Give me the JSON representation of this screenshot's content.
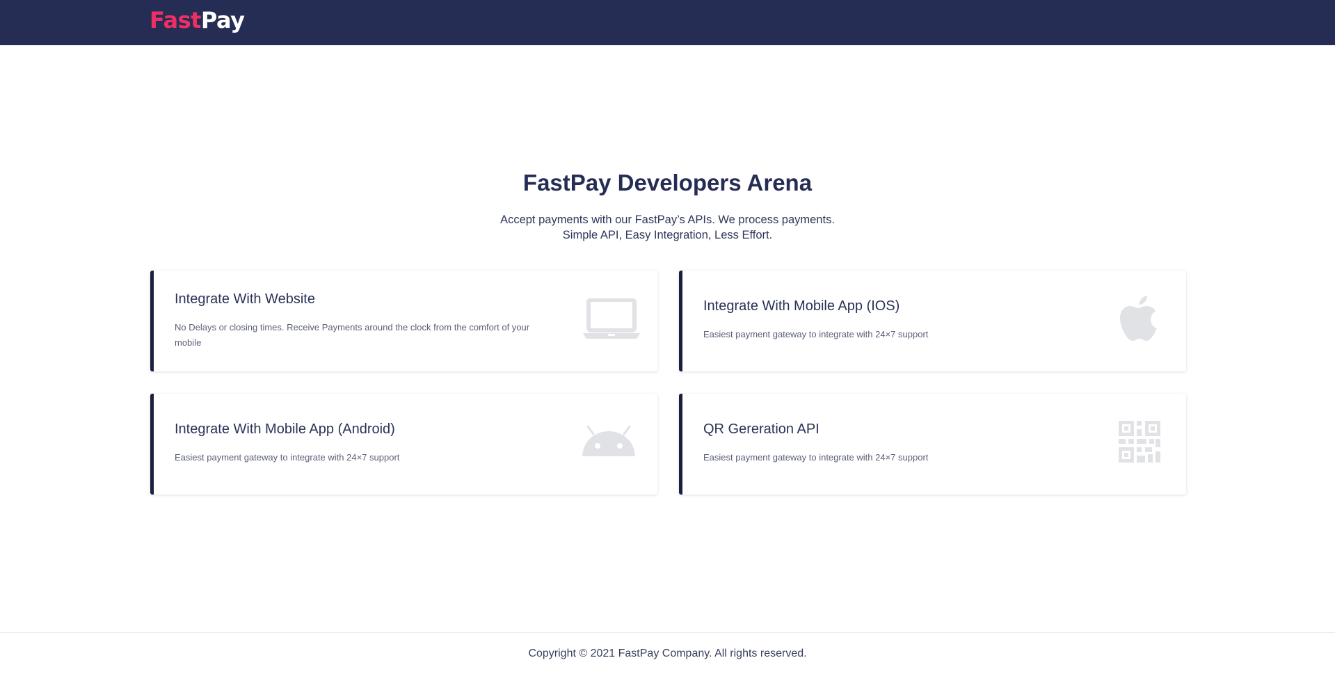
{
  "header": {
    "logo_part1": "Fast",
    "logo_part2": "Pay"
  },
  "hero": {
    "title": "FastPay Developers Arena",
    "subtitle_line1": "Accept payments with our FastPay’s APIs. We process payments.",
    "subtitle_line2": "Simple API, Easy Integration, Less Effort."
  },
  "cards": [
    {
      "title": "Integrate With Website",
      "description": "No Delays or closing times. Receive Payments around the clock from the comfort of your mobile",
      "icon": "laptop-icon"
    },
    {
      "title": "Integrate With Mobile App (IOS)",
      "description": "Easiest payment gateway to integrate with 24×7 support",
      "icon": "apple-icon"
    },
    {
      "title": "Integrate With Mobile App (Android)",
      "description": "Easiest payment gateway to integrate with 24×7 support",
      "icon": "android-icon"
    },
    {
      "title": "QR Gereration API",
      "description": "Easiest payment gateway to integrate with 24×7 support",
      "icon": "qr-code-icon"
    }
  ],
  "footer": {
    "copyright": "Copyright © 2021 FastPay Company. All rights reserved."
  },
  "colors": {
    "header_bg": "#252d54",
    "brand_pink": "#ee2f64",
    "card_accent": "#1a1f3d",
    "icon_gray": "#e1e2e6"
  }
}
